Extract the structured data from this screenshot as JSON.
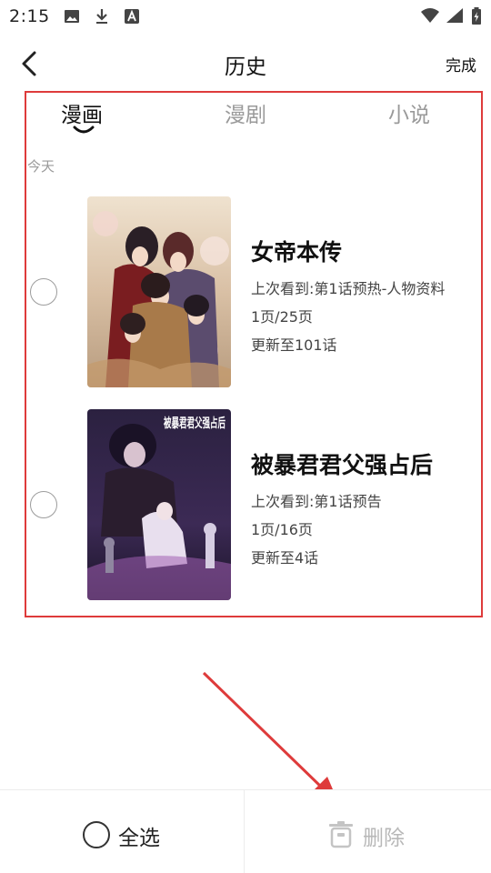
{
  "status_bar": {
    "time": "2:15",
    "left_icons": [
      "image-icon",
      "download-icon",
      "font-icon"
    ],
    "right_icons": [
      "wifi-icon",
      "signal-icon",
      "battery-charging-icon"
    ]
  },
  "header": {
    "title": "历史",
    "done_label": "完成"
  },
  "tabs": [
    {
      "label": "漫画",
      "active": true
    },
    {
      "label": "漫剧",
      "active": false
    },
    {
      "label": "小说",
      "active": false
    }
  ],
  "section": {
    "date_label": "今天"
  },
  "comics": [
    {
      "title": "女帝本传",
      "last_read": "上次看到:第1话预热-人物资料",
      "page": "1页/25页",
      "updated": "更新至101话",
      "selected": false
    },
    {
      "title": "被暴君君父强占后",
      "cover_text": "被暴君君父强占后",
      "last_read": "上次看到:第1话预告",
      "page": "1页/16页",
      "updated": "更新至4话",
      "selected": false
    }
  ],
  "bottom_bar": {
    "select_all_label": "全选",
    "delete_label": "删除"
  },
  "colors": {
    "annotation": "#de3b3b",
    "disabled_text": "#b8b8b8",
    "muted_text": "#9a9a9a"
  }
}
